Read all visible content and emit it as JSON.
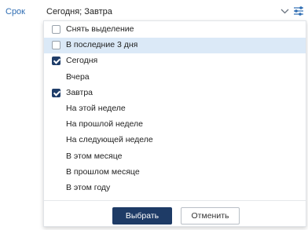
{
  "field": {
    "label": "Срок",
    "value": "Сегодня; Завтра",
    "chevron_icon": "chevron-down-icon",
    "settings_icon": "tune-icon"
  },
  "dropdown": {
    "options": [
      {
        "label": "Снять выделение",
        "checkbox": true,
        "checked": false,
        "highlighted": false
      },
      {
        "label": "В последние 3 дня",
        "checkbox": true,
        "checked": false,
        "highlighted": true
      },
      {
        "label": "Сегодня",
        "checkbox": true,
        "checked": true,
        "highlighted": false
      },
      {
        "label": "Вчера",
        "checkbox": false,
        "checked": false,
        "highlighted": false
      },
      {
        "label": "Завтра",
        "checkbox": true,
        "checked": true,
        "highlighted": false
      },
      {
        "label": "На этой неделе",
        "checkbox": false,
        "checked": false,
        "highlighted": false
      },
      {
        "label": "На прошлой неделе",
        "checkbox": false,
        "checked": false,
        "highlighted": false
      },
      {
        "label": "На следующей неделе",
        "checkbox": false,
        "checked": false,
        "highlighted": false
      },
      {
        "label": "В этом месяце",
        "checkbox": false,
        "checked": false,
        "highlighted": false
      },
      {
        "label": "В прошлом месяце",
        "checkbox": false,
        "checked": false,
        "highlighted": false
      },
      {
        "label": "В этом году",
        "checkbox": false,
        "checked": false,
        "highlighted": false
      }
    ],
    "apply_label": "Выбрать",
    "cancel_label": "Отменить"
  },
  "colors": {
    "accent": "#1e3b66",
    "label_blue": "#2f6db3",
    "highlight": "#dbe9f7"
  }
}
